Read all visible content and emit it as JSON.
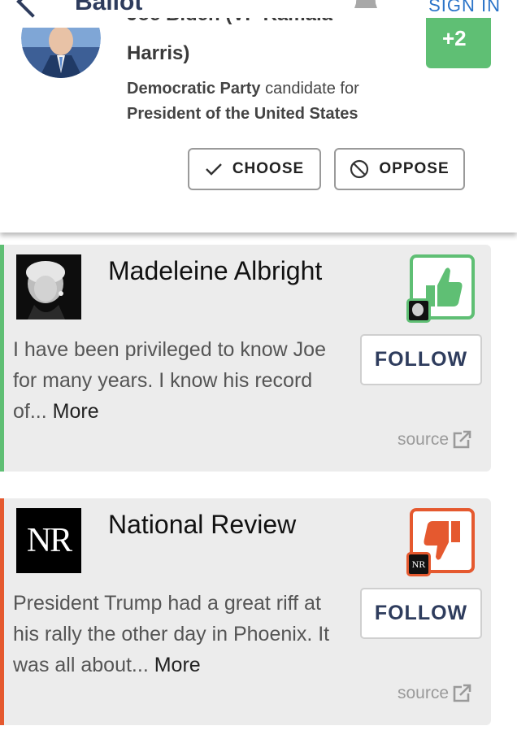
{
  "header": {
    "title": "Ballot",
    "sign_in": "SIGN IN"
  },
  "candidate": {
    "name_top_partial": "Joe Biden (VP Kamala",
    "name_bottom": "Harris)",
    "party": "Democratic Party",
    "party_suffix": " candidate for",
    "office": "President of the United States",
    "score": "+2",
    "choose_label": "CHOOSE",
    "oppose_label": "OPPOSE"
  },
  "opinions": [
    {
      "name": "Madeleine Albright",
      "stance": "support",
      "text": "I have been privileged to know Joe for many years. I know his record of...",
      "more_label": "More",
      "follow_label": "FOLLOW",
      "source_label": "source",
      "accent": "#5fbf74"
    },
    {
      "name": "National Review",
      "logo_text": "NR",
      "stance": "oppose",
      "text": "President Trump had a great riff at his rally the other day in Phoenix. It was all about...",
      "more_label": "More",
      "follow_label": "FOLLOW",
      "source_label": "source",
      "accent": "#e5592f"
    }
  ],
  "icons": {
    "back": "chevron-left-icon",
    "bell": "bell-icon",
    "choose": "checkmark-icon",
    "oppose": "ban-icon",
    "support_vote": "thumbs-up-icon",
    "oppose_vote": "thumbs-down-icon",
    "source": "external-link-icon"
  }
}
